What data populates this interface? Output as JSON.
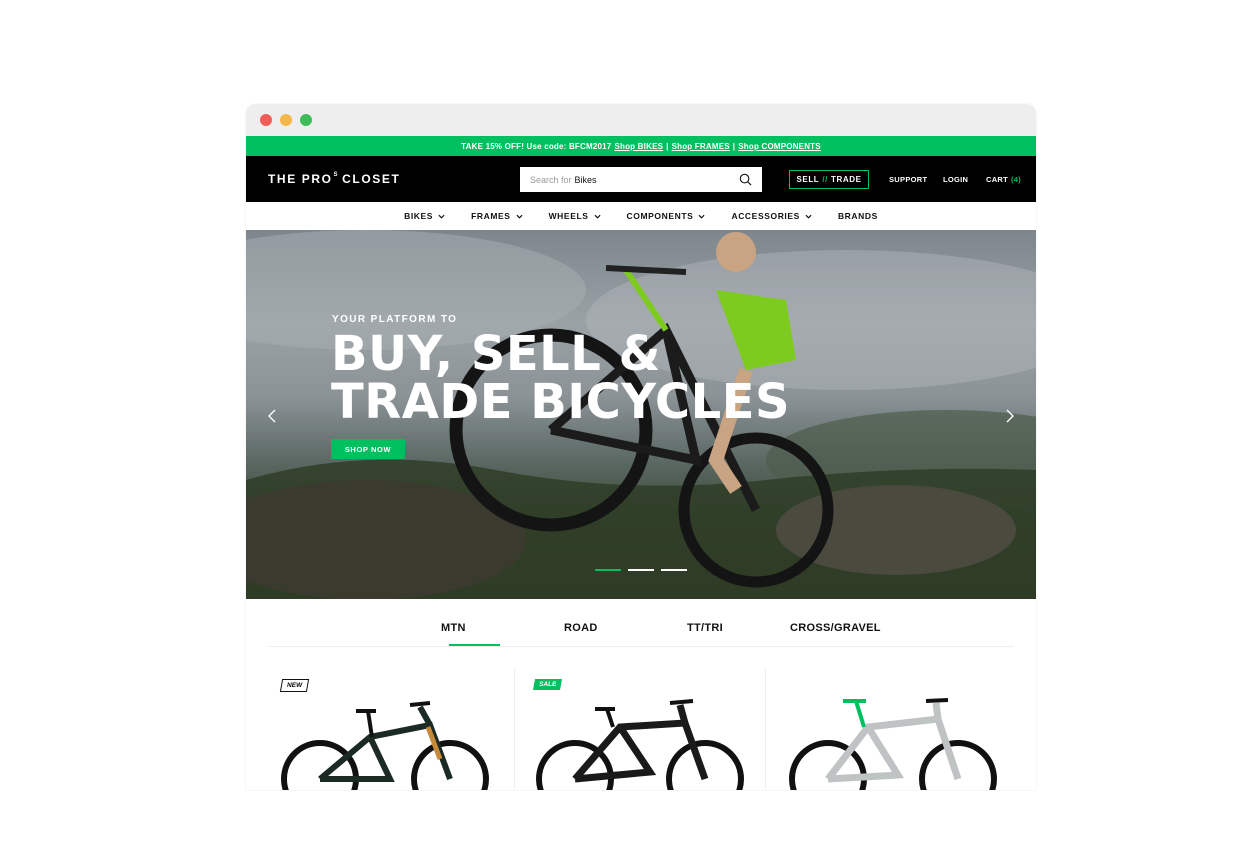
{
  "promo": {
    "text": "TAKE 15% OFF! Use code: BFCM2017",
    "links": [
      "Shop BIKES",
      "Shop FRAMES",
      "Shop COMPONENTS"
    ],
    "separator": "|"
  },
  "header": {
    "logo_part1": "THE PRO",
    "logo_sup": "S",
    "logo_part2": "CLOSET",
    "search_placeholder": "Search for",
    "search_value": "Bikes",
    "sell_label_a": "SELL",
    "sell_slash": "//",
    "sell_label_b": "TRADE",
    "support": "SUPPORT",
    "login": "LOGIN",
    "cart": "CART",
    "cart_count": "(4)"
  },
  "nav": {
    "items": [
      {
        "label": "BIKES",
        "dropdown": true
      },
      {
        "label": "FRAMES",
        "dropdown": true
      },
      {
        "label": "WHEELS",
        "dropdown": true
      },
      {
        "label": "COMPONENTS",
        "dropdown": true
      },
      {
        "label": "ACCESSORIES",
        "dropdown": true
      },
      {
        "label": "BRANDS",
        "dropdown": false
      }
    ]
  },
  "hero": {
    "eyebrow": "YOUR PLATFORM TO",
    "line1": "BUY, SELL &",
    "line2": "TRADE BICYCLES",
    "cta": "SHOP NOW",
    "slides": 3,
    "active_slide": 1
  },
  "tabs": {
    "items": [
      "MTN",
      "ROAD",
      "TT/TRI",
      "CROSS/GRAVEL"
    ],
    "active": "MTN"
  },
  "products": {
    "badges": [
      "NEW",
      "SALE",
      ""
    ]
  },
  "colors": {
    "accent": "#00bf5f",
    "header_bg": "#000000"
  }
}
